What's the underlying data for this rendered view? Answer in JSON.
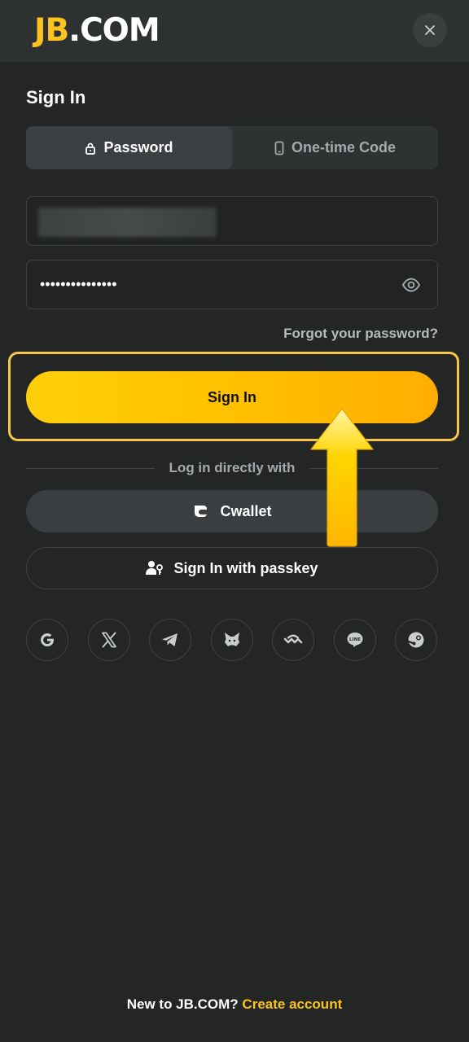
{
  "header": {
    "logo_jb": "JB",
    "logo_com": ".COM",
    "close_icon": "close-icon"
  },
  "form": {
    "title": "Sign In",
    "tabs": [
      {
        "label": "Password",
        "icon": "lock-icon",
        "active": true
      },
      {
        "label": "One-time Code",
        "icon": "phone-icon",
        "active": false
      }
    ],
    "password_value": "•••••••••••••••",
    "forgot_label": "Forgot your password?",
    "submit_label": "Sign In"
  },
  "alt_login": {
    "divider_label": "Log in directly with",
    "cwallet_label": "Cwallet",
    "passkey_label": "Sign In with passkey",
    "socials": [
      "google-icon",
      "x-icon",
      "telegram-icon",
      "metamask-icon",
      "walletconnect-icon",
      "line-icon",
      "steam-icon"
    ]
  },
  "footer": {
    "question": "New to JB.COM?",
    "link": "Create account"
  },
  "colors": {
    "accent": "#fcc31e",
    "background": "#242626",
    "highlight_border": "#f6c64c"
  }
}
